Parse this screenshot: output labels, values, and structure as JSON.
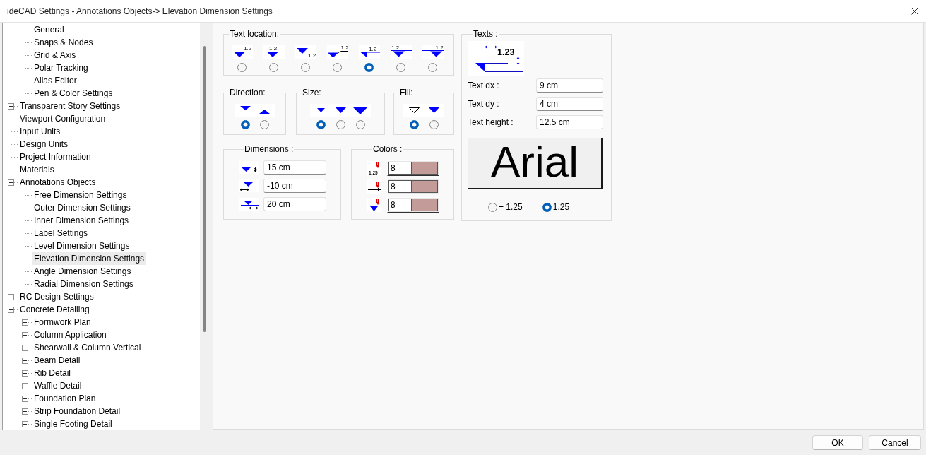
{
  "window": {
    "title": "ideCAD Settings - Annotations Objects-> Elevation Dimension Settings"
  },
  "tree": {
    "items_under_scrolled_parent": [
      {
        "label": "General",
        "selected": false
      },
      {
        "label": "Snaps & Nodes",
        "selected": false
      },
      {
        "label": "Grid & Axis",
        "selected": false
      },
      {
        "label": "Polar Tracking",
        "selected": false
      },
      {
        "label": "Alias Editor",
        "selected": false
      },
      {
        "label": "Pen & Color Settings",
        "selected": false
      }
    ],
    "items": [
      {
        "label": "Transparent Story Settings",
        "selected": false,
        "expanded": false
      },
      {
        "label": "Viewport Configuration",
        "selected": false
      },
      {
        "label": "Input Units",
        "selected": false
      },
      {
        "label": "Design Units",
        "selected": false
      },
      {
        "label": "Project Information",
        "selected": false
      },
      {
        "label": "Materials",
        "selected": false
      },
      {
        "label": "Annotations Objects",
        "selected": false,
        "expanded": true,
        "children": [
          {
            "label": "Free Dimension Settings",
            "selected": false
          },
          {
            "label": "Outer Dimension Settings",
            "selected": false
          },
          {
            "label": "Inner Dimension Settings",
            "selected": false
          },
          {
            "label": "Label Settings",
            "selected": false
          },
          {
            "label": "Level Dimension Settings",
            "selected": false
          },
          {
            "label": "Elevation Dimension Settings",
            "selected": true
          },
          {
            "label": "Angle Dimension Settings",
            "selected": false
          },
          {
            "label": "Radial Dimension Settings",
            "selected": false
          }
        ]
      },
      {
        "label": "RC Design Settings",
        "selected": false,
        "expanded": false
      },
      {
        "label": "Concrete Detailing",
        "selected": false,
        "expanded": true,
        "children": [
          {
            "label": "Formwork Plan",
            "selected": false,
            "expanded": false
          },
          {
            "label": "Column Application",
            "selected": false,
            "expanded": false
          },
          {
            "label": "Shearwall & Column Vertical",
            "selected": false,
            "expanded": false
          },
          {
            "label": "Beam Detail",
            "selected": false,
            "expanded": false
          },
          {
            "label": "Rib Detail",
            "selected": false,
            "expanded": false
          },
          {
            "label": "Waffle Detail",
            "selected": false,
            "expanded": false
          },
          {
            "label": "Foundation Plan",
            "selected": false,
            "expanded": false
          },
          {
            "label": "Strip Foundation Detail",
            "selected": false,
            "expanded": false
          },
          {
            "label": "Single Footing Detail",
            "selected": false,
            "expanded": false
          }
        ]
      }
    ]
  },
  "text_location": {
    "title": "Text location:",
    "options": [
      {
        "kind": "above-right",
        "label": "1.2",
        "selected": false
      },
      {
        "kind": "above",
        "label": "1.2",
        "selected": false
      },
      {
        "kind": "below-right",
        "label": "1.2",
        "selected": false
      },
      {
        "kind": "leader",
        "label": "1.2",
        "selected": false
      },
      {
        "kind": "flag",
        "label": "1.2",
        "selected": true
      },
      {
        "kind": "line-above",
        "label": "1.2",
        "selected": false
      },
      {
        "kind": "line-right",
        "label": "1.2",
        "selected": false
      }
    ]
  },
  "direction": {
    "title": "Direction:",
    "options": [
      {
        "kind": "down",
        "selected": true
      },
      {
        "kind": "up",
        "selected": false
      }
    ]
  },
  "size": {
    "title": "Size:",
    "options": [
      {
        "kind": "small",
        "selected": true
      },
      {
        "kind": "medium",
        "selected": false
      },
      {
        "kind": "large",
        "selected": false
      }
    ]
  },
  "fill": {
    "title": "Fill:",
    "options": [
      {
        "kind": "hollow",
        "selected": true
      },
      {
        "kind": "filled",
        "selected": false
      }
    ]
  },
  "dimensions": {
    "title": "Dimensions :",
    "rows": [
      {
        "kind": "above",
        "value": "15 cm"
      },
      {
        "kind": "below-left",
        "value": "-10 cm"
      },
      {
        "kind": "below-right",
        "value": "20 cm"
      }
    ]
  },
  "colors": {
    "title": "Colors :",
    "rows": [
      {
        "kind": "text",
        "label": "1.25",
        "value": "8",
        "color": "#c39b99"
      },
      {
        "kind": "line",
        "value": "8",
        "color": "#c39b99"
      },
      {
        "kind": "marker",
        "value": "8",
        "color": "#c39b99"
      }
    ]
  },
  "texts": {
    "title": "Texts :",
    "preview_label": "1.23",
    "fields": [
      {
        "label": "Text dx :",
        "value": "9 cm"
      },
      {
        "label": "Text dy :",
        "value": "4 cm"
      },
      {
        "label": "Text height :",
        "value": "12.5 cm"
      }
    ],
    "font_button": "Arial",
    "radios": [
      {
        "label": "+ 1.25",
        "selected": false
      },
      {
        "label": "1.25",
        "selected": true
      }
    ]
  },
  "buttons": [
    "OK",
    "Cancel"
  ]
}
